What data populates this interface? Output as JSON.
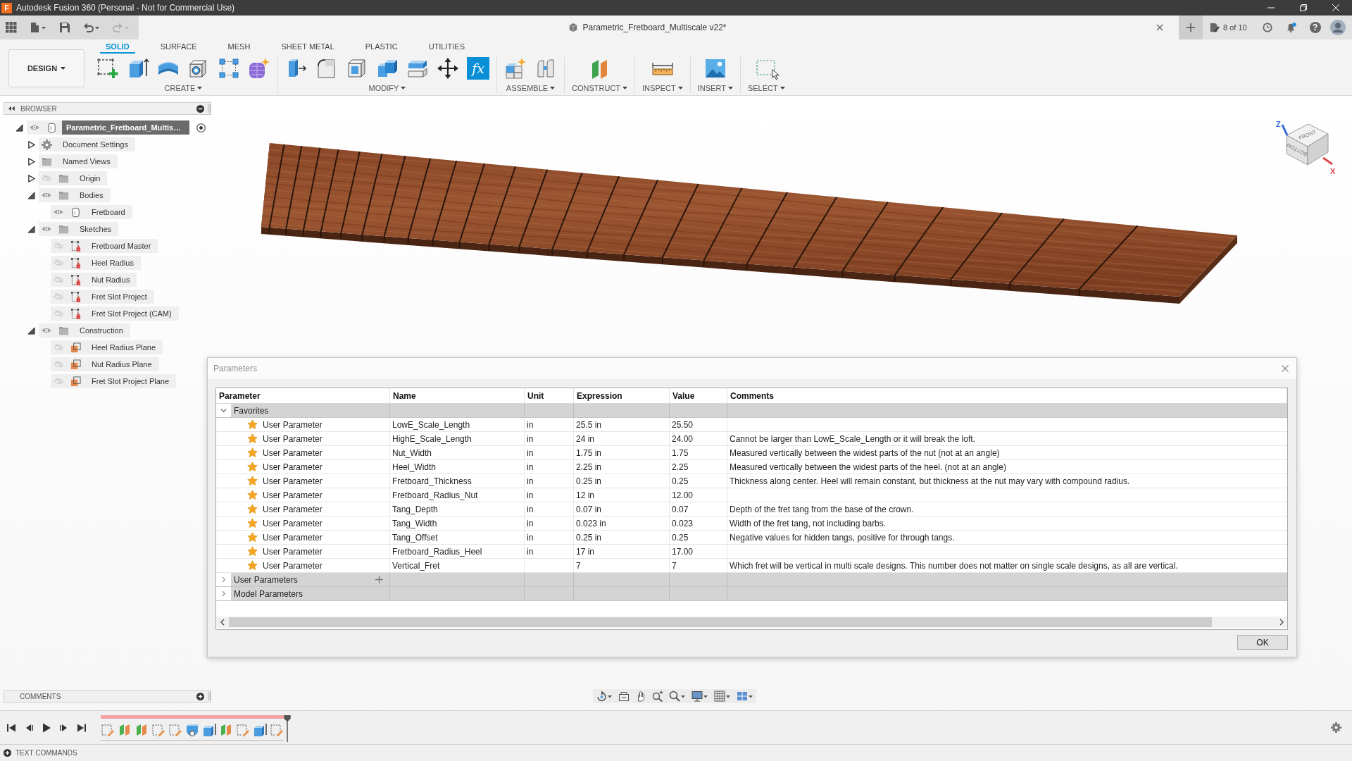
{
  "window": {
    "logo": "F",
    "title": "Autodesk Fusion 360 (Personal - Not for Commercial Use)"
  },
  "quick_access": [
    {
      "kind": "apps",
      "disabled": false
    },
    {
      "kind": "file",
      "disabled": false
    },
    {
      "kind": "save",
      "disabled": false
    },
    {
      "kind": "undo",
      "disabled": false
    },
    {
      "kind": "redo",
      "disabled": true
    }
  ],
  "document_tab": {
    "title": "Parametric_Fretboard_Multiscale v22*"
  },
  "jobs": {
    "label": "8 of 10"
  },
  "help": {
    "glyph": "?"
  },
  "workspace": {
    "label": "DESIGN"
  },
  "toolbar_tabs": [
    {
      "label": "SOLID",
      "selected": true
    },
    {
      "label": "SURFACE",
      "selected": false
    },
    {
      "label": "MESH",
      "selected": false
    },
    {
      "label": "SHEET METAL",
      "selected": false
    },
    {
      "label": "PLASTIC",
      "selected": false
    },
    {
      "label": "UTILITIES",
      "selected": false
    }
  ],
  "tool_groups": [
    {
      "label": "CREATE",
      "tools": [
        {
          "kind": "sketch"
        },
        {
          "kind": "extrude"
        },
        {
          "kind": "revolve"
        },
        {
          "kind": "hole"
        },
        {
          "kind": "pattern"
        },
        {
          "kind": "form"
        }
      ]
    },
    {
      "label": "MODIFY",
      "tools": [
        {
          "kind": "presspull"
        },
        {
          "kind": "fillet"
        },
        {
          "kind": "shell"
        },
        {
          "kind": "combine"
        },
        {
          "kind": "split"
        },
        {
          "kind": "move"
        },
        {
          "kind": "formula",
          "glyph": "fx"
        }
      ]
    },
    {
      "label": "ASSEMBLE",
      "tools": [
        {
          "kind": "component"
        },
        {
          "kind": "joint"
        }
      ]
    },
    {
      "label": "CONSTRUCT",
      "tools": [
        {
          "kind": "plane"
        }
      ]
    },
    {
      "label": "INSPECT",
      "tools": [
        {
          "kind": "measure"
        }
      ]
    },
    {
      "label": "INSERT",
      "tools": [
        {
          "kind": "image"
        }
      ]
    },
    {
      "label": "SELECT",
      "tools": [
        {
          "kind": "select"
        }
      ]
    }
  ],
  "browser": {
    "title": "BROWSER",
    "tree": [
      {
        "label": "Parametric_Fretboard_Multis…",
        "kind": "component",
        "visible": true,
        "expanded": true,
        "selected": true,
        "children": [
          {
            "label": "Document Settings",
            "kind": "settings",
            "expanded": false,
            "selected": false
          },
          {
            "label": "Named Views",
            "kind": "folder",
            "expanded": false,
            "selected": false
          },
          {
            "label": "Origin",
            "kind": "folder",
            "visible": false,
            "expanded": false,
            "selected": false
          },
          {
            "label": "Bodies",
            "kind": "folder",
            "visible": true,
            "expanded": true,
            "selected": false,
            "children": [
              {
                "label": "Fretboard",
                "kind": "body",
                "visible": true,
                "selected": false
              }
            ]
          },
          {
            "label": "Sketches",
            "kind": "folder",
            "visible": true,
            "expanded": true,
            "selected": false,
            "children": [
              {
                "label": "Fretboard Master",
                "kind": "sketch",
                "visible": false,
                "selected": false
              },
              {
                "label": "Heel Radius",
                "kind": "sketch",
                "visible": false,
                "selected": false
              },
              {
                "label": "Nut Radius",
                "kind": "sketch",
                "visible": false,
                "selected": false
              },
              {
                "label": "Fret Slot Project",
                "kind": "sketch",
                "visible": false,
                "selected": false
              },
              {
                "label": "Fret Slot Project (CAM)",
                "kind": "sketch",
                "visible": false,
                "selected": false
              }
            ]
          },
          {
            "label": "Construction",
            "kind": "folder",
            "visible": true,
            "expanded": true,
            "selected": false,
            "children": [
              {
                "label": "Heel Radius Plane",
                "kind": "plane",
                "visible": false,
                "selected": false
              },
              {
                "label": "Nut Radius Plane",
                "kind": "plane",
                "visible": false,
                "selected": false
              },
              {
                "label": "Fret Slot Project Plane",
                "kind": "plane",
                "visible": false,
                "selected": false
              }
            ]
          }
        ]
      }
    ]
  },
  "view_cube": {
    "faces": [
      "FRONT",
      "BOTTOM"
    ],
    "axes": [
      {
        "label": "Z",
        "color": "#3a6fd8"
      },
      {
        "label": "X",
        "color": "#e0474c"
      }
    ]
  },
  "parameters_dialog": {
    "title": "Parameters",
    "columns": [
      "Parameter",
      "Name",
      "Unit",
      "Expression",
      "Value",
      "Comments"
    ],
    "groups": [
      {
        "label": "Favorites",
        "expanded": true,
        "can_add": false,
        "rows": [
          {
            "parameter": "User Parameter",
            "favorite": true,
            "name": "LowE_Scale_Length",
            "unit": "in",
            "expression": "25.5 in",
            "value": "25.50"
          },
          {
            "parameter": "User Parameter",
            "favorite": true,
            "name": "HighE_Scale_Length",
            "unit": "in",
            "expression": "24 in",
            "value": "24.00",
            "comments": "Cannot be larger than LowE_Scale_Length or it will break the loft."
          },
          {
            "parameter": "User Parameter",
            "favorite": true,
            "name": "Nut_Width",
            "unit": "in",
            "expression": "1.75 in",
            "value": "1.75",
            "comments": "Measured vertically between the widest parts of the nut (not at an angle)"
          },
          {
            "parameter": "User Parameter",
            "favorite": true,
            "name": "Heel_Width",
            "unit": "in",
            "expression": "2.25 in",
            "value": "2.25",
            "comments": "Measured vertically between the widest parts of the heel. (not at an angle)"
          },
          {
            "parameter": "User Parameter",
            "favorite": true,
            "name": "Fretboard_Thickness",
            "unit": "in",
            "expression": "0.25 in",
            "value": "0.25",
            "comments": "Thickness along center. Heel will remain constant, but thickness at the nut may vary with compound radius."
          },
          {
            "parameter": "User Parameter",
            "favorite": true,
            "name": "Fretboard_Radius_Nut",
            "unit": "in",
            "expression": "12 in",
            "value": "12.00"
          },
          {
            "parameter": "User Parameter",
            "favorite": true,
            "name": "Tang_Depth",
            "unit": "in",
            "expression": "0.07 in",
            "value": "0.07",
            "comments": "Depth of the fret tang from the base of the crown."
          },
          {
            "parameter": "User Parameter",
            "favorite": true,
            "name": "Tang_Width",
            "unit": "in",
            "expression": "0.023 in",
            "value": "0.023",
            "comments": "Width of the fret tang, not including barbs."
          },
          {
            "parameter": "User Parameter",
            "favorite": true,
            "name": "Tang_Offset",
            "unit": "in",
            "expression": "0.25 in",
            "value": "0.25",
            "comments": "Negative values for hidden tangs, positive for through tangs."
          },
          {
            "parameter": "User Parameter",
            "favorite": true,
            "name": "Fretboard_Radius_Heel",
            "unit": "in",
            "expression": "17 in",
            "value": "17.00"
          },
          {
            "parameter": "User Parameter",
            "favorite": true,
            "name": "Vertical_Fret",
            "expression": "7",
            "value": "7",
            "comments": "Which fret will be vertical in multi scale designs. This number does not matter on single scale designs, as all are vertical."
          }
        ]
      },
      {
        "label": "User Parameters",
        "expanded": false,
        "can_add": true
      },
      {
        "label": "Model Parameters",
        "expanded": false,
        "can_add": false
      }
    ],
    "buttons": [
      "OK"
    ]
  },
  "comments_panel": {
    "title": "COMMENTS"
  },
  "timeline": {
    "features": [
      {
        "kind": "sketch"
      },
      {
        "kind": "plane"
      },
      {
        "kind": "plane"
      },
      {
        "kind": "sketch"
      },
      {
        "kind": "sketch"
      },
      {
        "kind": "hole"
      },
      {
        "kind": "extrude"
      },
      {
        "kind": "plane"
      },
      {
        "kind": "sketch"
      },
      {
        "kind": "extrude"
      },
      {
        "kind": "sketch"
      }
    ]
  },
  "text_commands": {
    "title": "TEXT COMMANDS"
  }
}
